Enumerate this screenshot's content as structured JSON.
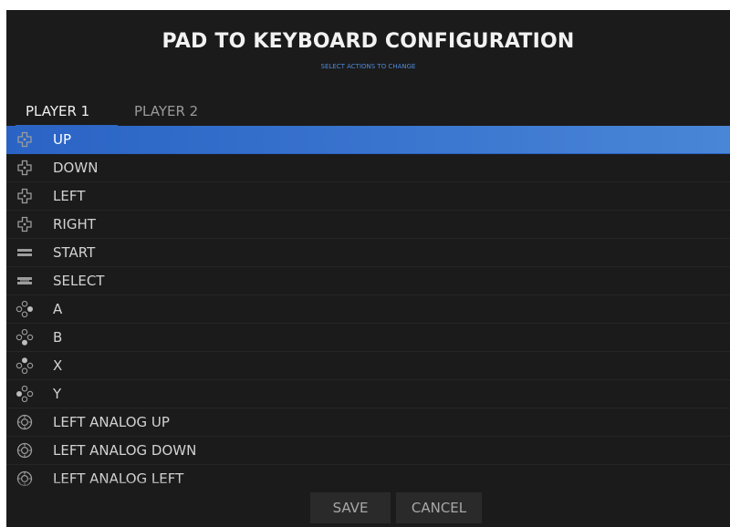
{
  "header": {
    "title": "PAD TO KEYBOARD CONFIGURATION",
    "subtitle": "SELECT ACTIONS TO CHANGE"
  },
  "tabs": [
    {
      "label": "PLAYER 1",
      "active": true
    },
    {
      "label": "PLAYER 2",
      "active": false
    }
  ],
  "actions": [
    {
      "label": "UP",
      "icon": "dpad-icon",
      "selected": true
    },
    {
      "label": "DOWN",
      "icon": "dpad-icon"
    },
    {
      "label": "LEFT",
      "icon": "dpad-icon"
    },
    {
      "label": "RIGHT",
      "icon": "dpad-icon"
    },
    {
      "label": "START",
      "icon": "start-button-icon"
    },
    {
      "label": "SELECT",
      "icon": "select-button-icon"
    },
    {
      "label": "A",
      "icon": "face-button-a-icon"
    },
    {
      "label": "B",
      "icon": "face-button-b-icon"
    },
    {
      "label": "X",
      "icon": "face-button-x-icon"
    },
    {
      "label": "Y",
      "icon": "face-button-y-icon"
    },
    {
      "label": "LEFT ANALOG UP",
      "icon": "analog-stick-icon"
    },
    {
      "label": "LEFT ANALOG DOWN",
      "icon": "analog-stick-icon"
    },
    {
      "label": "LEFT ANALOG LEFT",
      "icon": "analog-stick-icon"
    }
  ],
  "footer": {
    "save_label": "SAVE",
    "cancel_label": "CANCEL"
  },
  "colors": {
    "background": "#1b1b1b",
    "accent": "#2e66b8",
    "selected_row": "#3a75cf",
    "subtitle": "#4f8ad8"
  }
}
